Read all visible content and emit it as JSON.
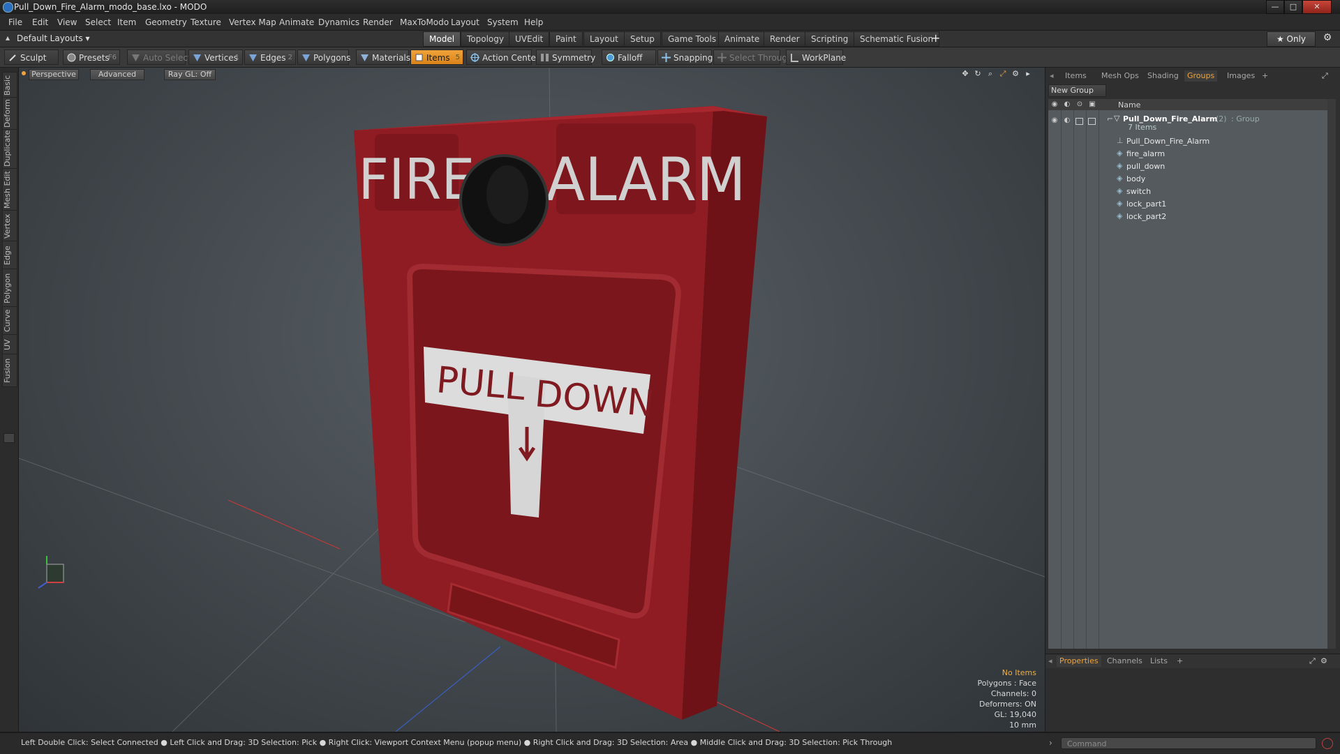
{
  "window": {
    "title": "Pull_Down_Fire_Alarm_modo_base.lxo - MODO",
    "min": "—",
    "max": "□",
    "close": "✕"
  },
  "menu": [
    "File",
    "Edit",
    "View",
    "Select",
    "Item",
    "Geometry",
    "Texture",
    "Vertex Map",
    "Animate",
    "Dynamics",
    "Render",
    "MaxToModo",
    "Layout",
    "System",
    "Help"
  ],
  "layout": {
    "preset": "Default Layouts ▾",
    "tabs": [
      "Model",
      "Topology",
      "UVEdit",
      "Paint",
      "Layout",
      "Setup",
      "Game Tools",
      "Animate",
      "Render",
      "Scripting",
      "Schematic Fusion"
    ],
    "active_tab": "Model",
    "add": "+",
    "only": "★  Only"
  },
  "toolbar": {
    "sculpt": "Sculpt",
    "presets": "Presets",
    "presets_hotkey": "F6",
    "auto_select": "Auto Select",
    "vertices": "Vertices",
    "vertices_hotkey": "1",
    "edges": "Edges",
    "edges_hotkey": "2",
    "polygons": "Polygons",
    "materials": "Materials",
    "items": "Items",
    "items_hotkey": "5",
    "action_center": "Action Center",
    "symmetry": "Symmetry",
    "falloff": "Falloff",
    "snapping": "Snapping",
    "select_through": "Select Through",
    "workplane": "WorkPlane"
  },
  "left_tabs": [
    "Basic",
    "Deform",
    "Duplicate",
    "Mesh Edit",
    "Vertex",
    "Edge",
    "Polygon",
    "Curve",
    "UV",
    "Fusion"
  ],
  "viewport": {
    "view": "Perspective",
    "shading": "Advanced",
    "raygl": "Ray GL: Off",
    "model_text": {
      "fire": "FIRE",
      "alarm": "ALARM",
      "pull": "PULL",
      "down": "DOWN"
    },
    "info": {
      "selection": "No Items",
      "polygons": "Polygons : Face",
      "channels": "Channels: 0",
      "deformers": "Deformers: ON",
      "gl": "GL: 19,040",
      "unit": "10 mm"
    }
  },
  "right_panel": {
    "tabs": [
      "Items",
      "Mesh Ops",
      "Shading",
      "Groups",
      "Images"
    ],
    "active_tab": "Groups",
    "add": "+",
    "new_group": "New Group",
    "column_name": "Name",
    "group": {
      "name": "Pull_Down_Fire_Alarm",
      "count": "(2)",
      "type": ": Group",
      "items_count": "7 Items"
    },
    "items": [
      "Pull_Down_Fire_Alarm",
      "fire_alarm",
      "pull_down",
      "body",
      "switch",
      "lock_part1",
      "lock_part2"
    ],
    "bottom_tabs": [
      "Properties",
      "Channels",
      "Lists"
    ],
    "bottom_active": "Properties"
  },
  "status": {
    "hint": "Left Double Click: Select Connected ● Left Click and Drag: 3D Selection: Pick ● Right Click: Viewport Context Menu (popup menu) ● Right Click and Drag: 3D Selection: Area ● Middle Click and Drag: 3D Selection: Pick Through",
    "command_placeholder": "Command"
  },
  "colors": {
    "accent": "#f0a33a",
    "alarm_red": "#8e1c22"
  }
}
